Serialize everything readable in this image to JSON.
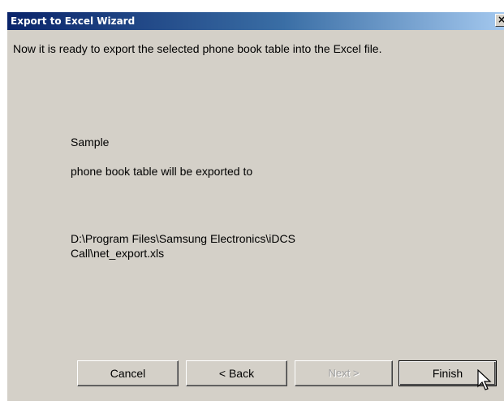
{
  "window": {
    "title": "Export to Excel Wizard",
    "close_glyph": "×"
  },
  "content": {
    "instruction": "Now it is ready to export the selected phone book table into the Excel file.",
    "table_name": "Sample",
    "description": "phone book table will be exported to",
    "file_path": "D:\\Program Files\\Samsung Electronics\\iDCS Call\\net_export.xls"
  },
  "buttons": {
    "cancel": "Cancel",
    "back": "< Back",
    "next": "Next >",
    "finish": "Finish"
  },
  "state": {
    "next_enabled": false
  },
  "colors": {
    "dialog_bg": "#d4d0c8",
    "titlebar": "#0a246a"
  },
  "icons": {
    "cursor": "arrow-pointer-icon"
  }
}
